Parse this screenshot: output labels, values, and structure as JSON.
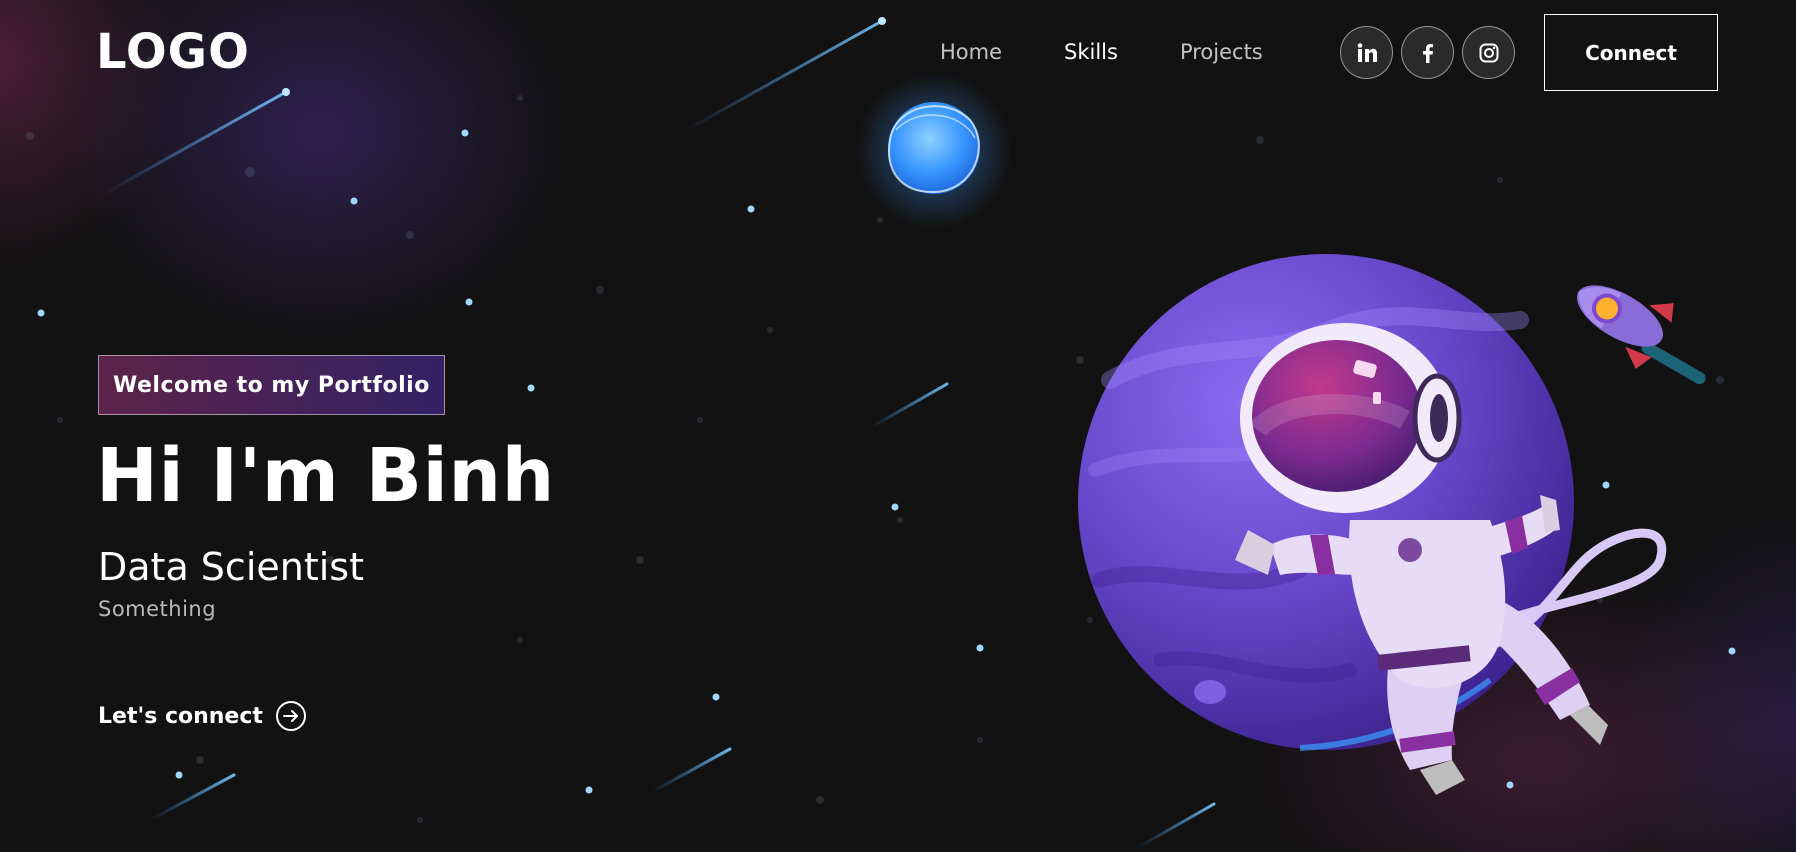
{
  "nav": {
    "logo": "LOGO",
    "links": [
      {
        "label": "Home",
        "active": false
      },
      {
        "label": "Skills",
        "active": true
      },
      {
        "label": "Projects",
        "active": false
      }
    ],
    "socials": [
      {
        "icon": "linkedin-icon",
        "glyph": "in"
      },
      {
        "icon": "facebook-icon",
        "glyph": "f"
      },
      {
        "icon": "instagram-icon",
        "glyph": ""
      }
    ],
    "connect_label": "Connect"
  },
  "hero": {
    "tagline": "Welcome to my Portfolio",
    "title": "Hi I'm Binh",
    "role": "Data Scientist",
    "subtitle": "Something",
    "cta_label": "Let's connect",
    "cta_icon": "arrow-right-circle-icon"
  },
  "colors": {
    "background": "#121212",
    "tagline_gradient_start": "#AA367C",
    "tagline_gradient_end": "#4A2FBD",
    "planet": "#6a48d0",
    "blue_planet": "#4aa3ff"
  }
}
